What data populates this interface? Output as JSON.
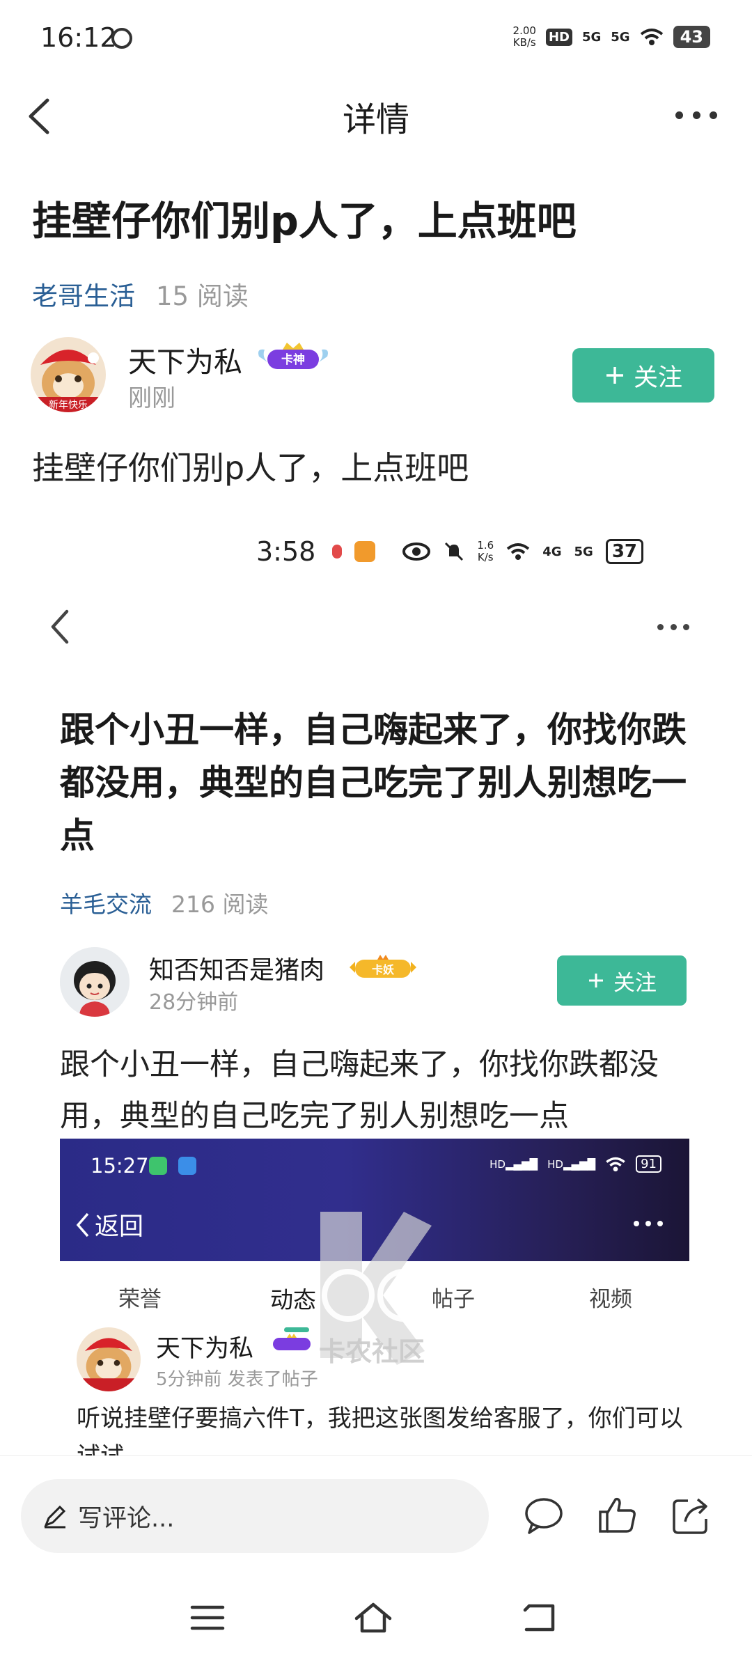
{
  "status_bar": {
    "time": "16:12",
    "speed_value": "2.00",
    "speed_unit": "KB/s",
    "hd": "HD",
    "net1": "5G",
    "net2": "5G",
    "battery": "43"
  },
  "header": {
    "title": "详情"
  },
  "post": {
    "title": "挂壁仔你们别p人了，上点班吧",
    "category": "老哥生活",
    "reads": "15 阅读",
    "author": {
      "name": "天下为私",
      "badge": "卡神",
      "time": "刚刚",
      "avatar_text": "新年快乐"
    },
    "follow_label": "关注",
    "body": "挂壁仔你们别p人了，上点班吧"
  },
  "embed": {
    "status_time": "3:58",
    "status_speed_value": "1.6",
    "status_speed_unit": "K/s",
    "status_net1": "4G",
    "status_net2": "5G",
    "status_battery": "37",
    "title": "跟个小丑一样，自己嗨起来了，你找你跌都没用，典型的自己吃完了别人别想吃一点",
    "category": "羊毛交流",
    "reads": "216 阅读",
    "author": {
      "name": "知否知否是猪肉",
      "badge": "卡妖",
      "time": "28分钟前"
    },
    "follow_label": "关注",
    "body": "跟个小丑一样，自己嗨起来了，你找你跌都没用，典型的自己吃完了别人别想吃一点",
    "inner": {
      "time": "15:27",
      "battery": "91",
      "back_label": "返回",
      "tabs": [
        "荣誉",
        "动态",
        "帖子",
        "视频"
      ],
      "active_tab": "动态",
      "author": {
        "name": "天下为私",
        "time": "5分钟前 发表了帖子"
      },
      "body": "听说挂壁仔要搞六件T，我把这张图发给客服了，你们可以试试"
    },
    "watermark": "卡农社区"
  },
  "bottom_bar": {
    "comment_placeholder": "写评论...",
    "icons": [
      "comment-icon",
      "like-icon",
      "share-icon"
    ]
  },
  "nav_bar": {
    "icons": [
      "menu-icon",
      "home-icon",
      "back-icon"
    ]
  },
  "colors": {
    "accent": "#3db897",
    "category": "#2a5f95",
    "muted": "#999999"
  }
}
